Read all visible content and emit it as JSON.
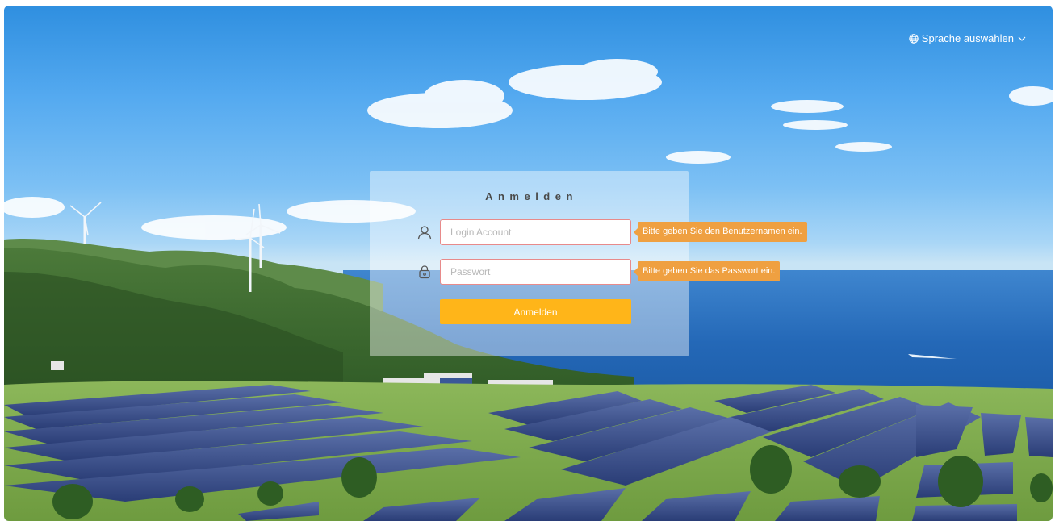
{
  "header": {
    "language_label": "Sprache auswählen",
    "language_icon": "globe-icon",
    "dropdown_icon": "chevron-down-icon"
  },
  "login": {
    "title": "Anmelden",
    "username": {
      "icon": "user-icon",
      "placeholder": "Login Account",
      "value": "",
      "error": "Bitte geben Sie den Benutzernamen ein."
    },
    "password": {
      "icon": "lock-icon",
      "placeholder": "Passwort",
      "value": "",
      "error": "Bitte geben Sie das Passwort ein."
    },
    "submit_label": "Anmelden"
  },
  "background": {
    "subject": "solar-farm-with-wind-turbines-by-the-sea"
  },
  "colors": {
    "accent": "#ffb519",
    "error": "#efa041",
    "input_border_error": "#e88a8a",
    "text_light": "#ffffff"
  }
}
